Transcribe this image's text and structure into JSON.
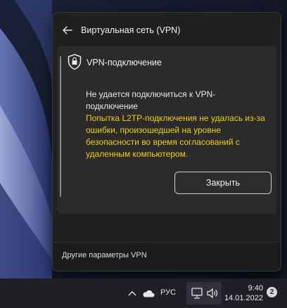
{
  "flyout": {
    "title": "Виртуальная сеть (VPN)",
    "connection_name": "VPN-подключение",
    "message_main": "Не удается подключиться к VPN-подключение",
    "message_error": "Попытка L2TP-подключения не удалась из-за ошибки, произошедшей на уровне безопасности во время согласований с удаленным компьютером.",
    "close_label": "Закрыть",
    "footer_link": "Другие параметры VPN",
    "colors": {
      "error_text": "#f3d000",
      "panel_bg": "#202020",
      "card_bg": "#2b2b2b"
    }
  },
  "taskbar": {
    "language": "РУС",
    "time": "9:40",
    "date": "14.01.2022",
    "notification_count": "2",
    "icons": [
      "chevron-up-icon",
      "onedrive-cloud-icon",
      "network-icon",
      "volume-icon"
    ]
  }
}
